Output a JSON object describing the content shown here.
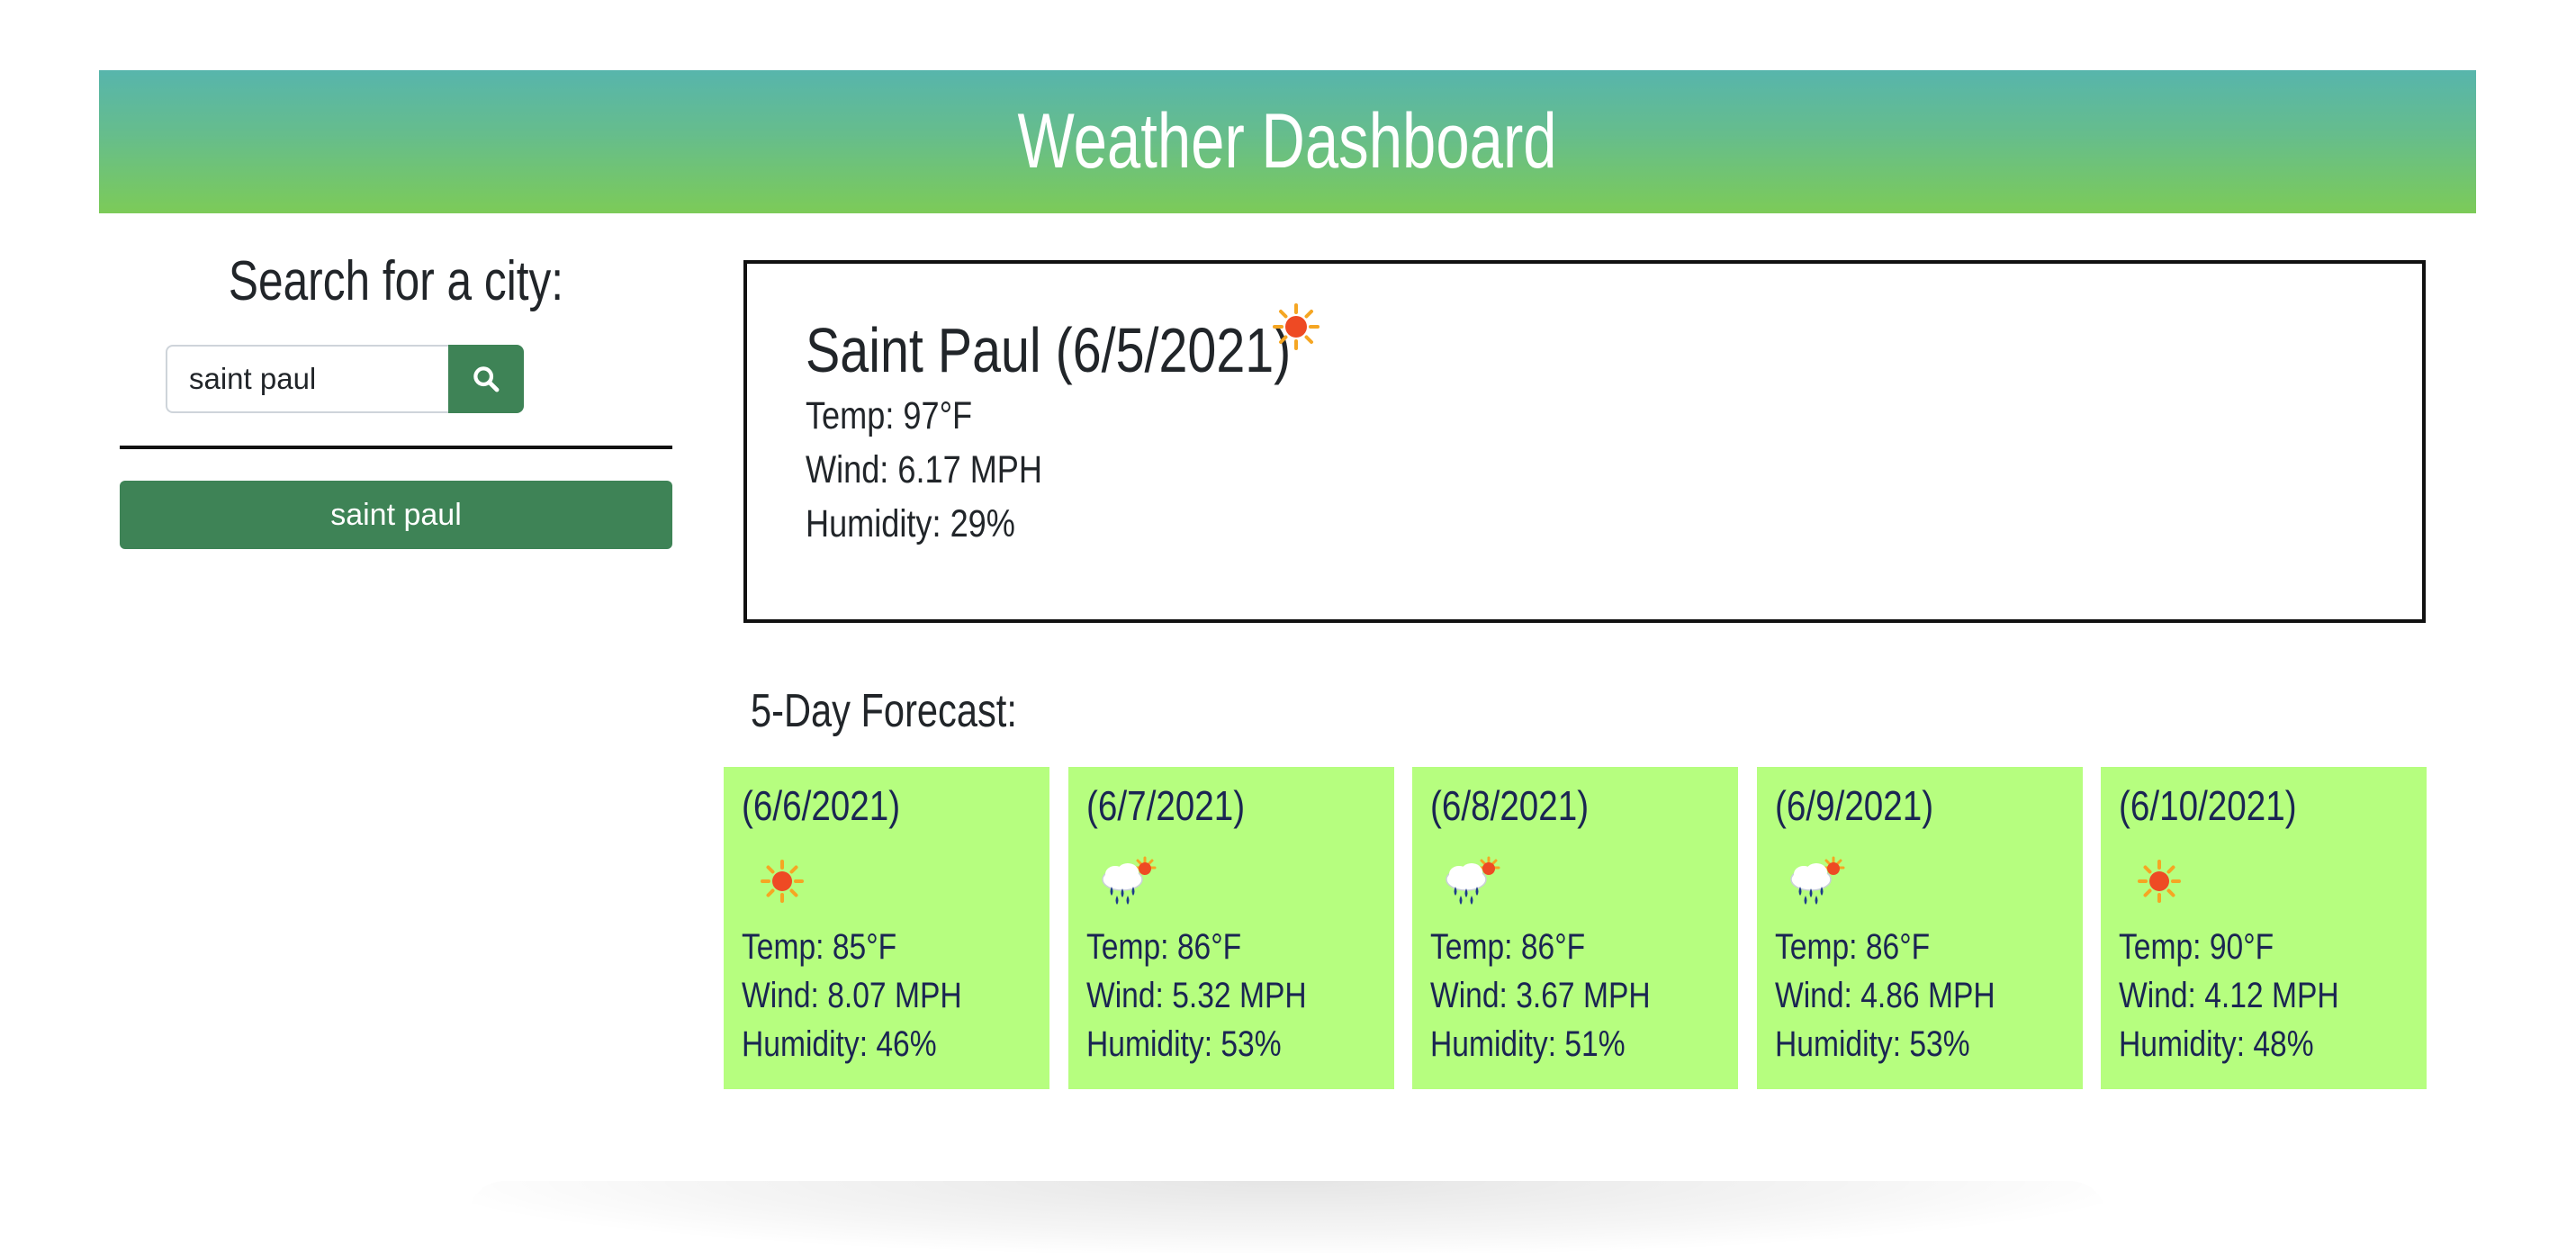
{
  "header": {
    "title": "Weather Dashboard",
    "gradient_top": "#57b5ac",
    "gradient_bottom": "#7ccb58"
  },
  "sidebar": {
    "search_title": "Search for a city:",
    "search_value": "saint paul",
    "search_button_icon": "search-icon",
    "history": [
      "saint paul"
    ],
    "button_color": "#3e8356"
  },
  "current": {
    "title": "Saint Paul (6/5/2021)",
    "icon": "sun-icon",
    "temp": "Temp: 97°F",
    "wind": "Wind: 6.17 MPH",
    "humidity": "Humidity: 29%"
  },
  "forecast": {
    "heading": "5-Day Forecast:",
    "card_color": "#b6fe7f",
    "days": [
      {
        "date": "(6/6/2021)",
        "icon": "sun-icon",
        "temp": "Temp: 85°F",
        "wind": "Wind: 8.07 MPH",
        "humidity": "Humidity: 46%"
      },
      {
        "date": "(6/7/2021)",
        "icon": "rain-sun-icon",
        "temp": "Temp: 86°F",
        "wind": "Wind: 5.32 MPH",
        "humidity": "Humidity: 53%"
      },
      {
        "date": "(6/8/2021)",
        "icon": "rain-sun-icon",
        "temp": "Temp: 86°F",
        "wind": "Wind: 3.67 MPH",
        "humidity": "Humidity: 51%"
      },
      {
        "date": "(6/9/2021)",
        "icon": "rain-sun-icon",
        "temp": "Temp: 86°F",
        "wind": "Wind: 4.86 MPH",
        "humidity": "Humidity: 53%"
      },
      {
        "date": "(6/10/2021)",
        "icon": "sun-icon",
        "temp": "Temp: 90°F",
        "wind": "Wind: 4.12 MPH",
        "humidity": "Humidity: 48%"
      }
    ]
  }
}
